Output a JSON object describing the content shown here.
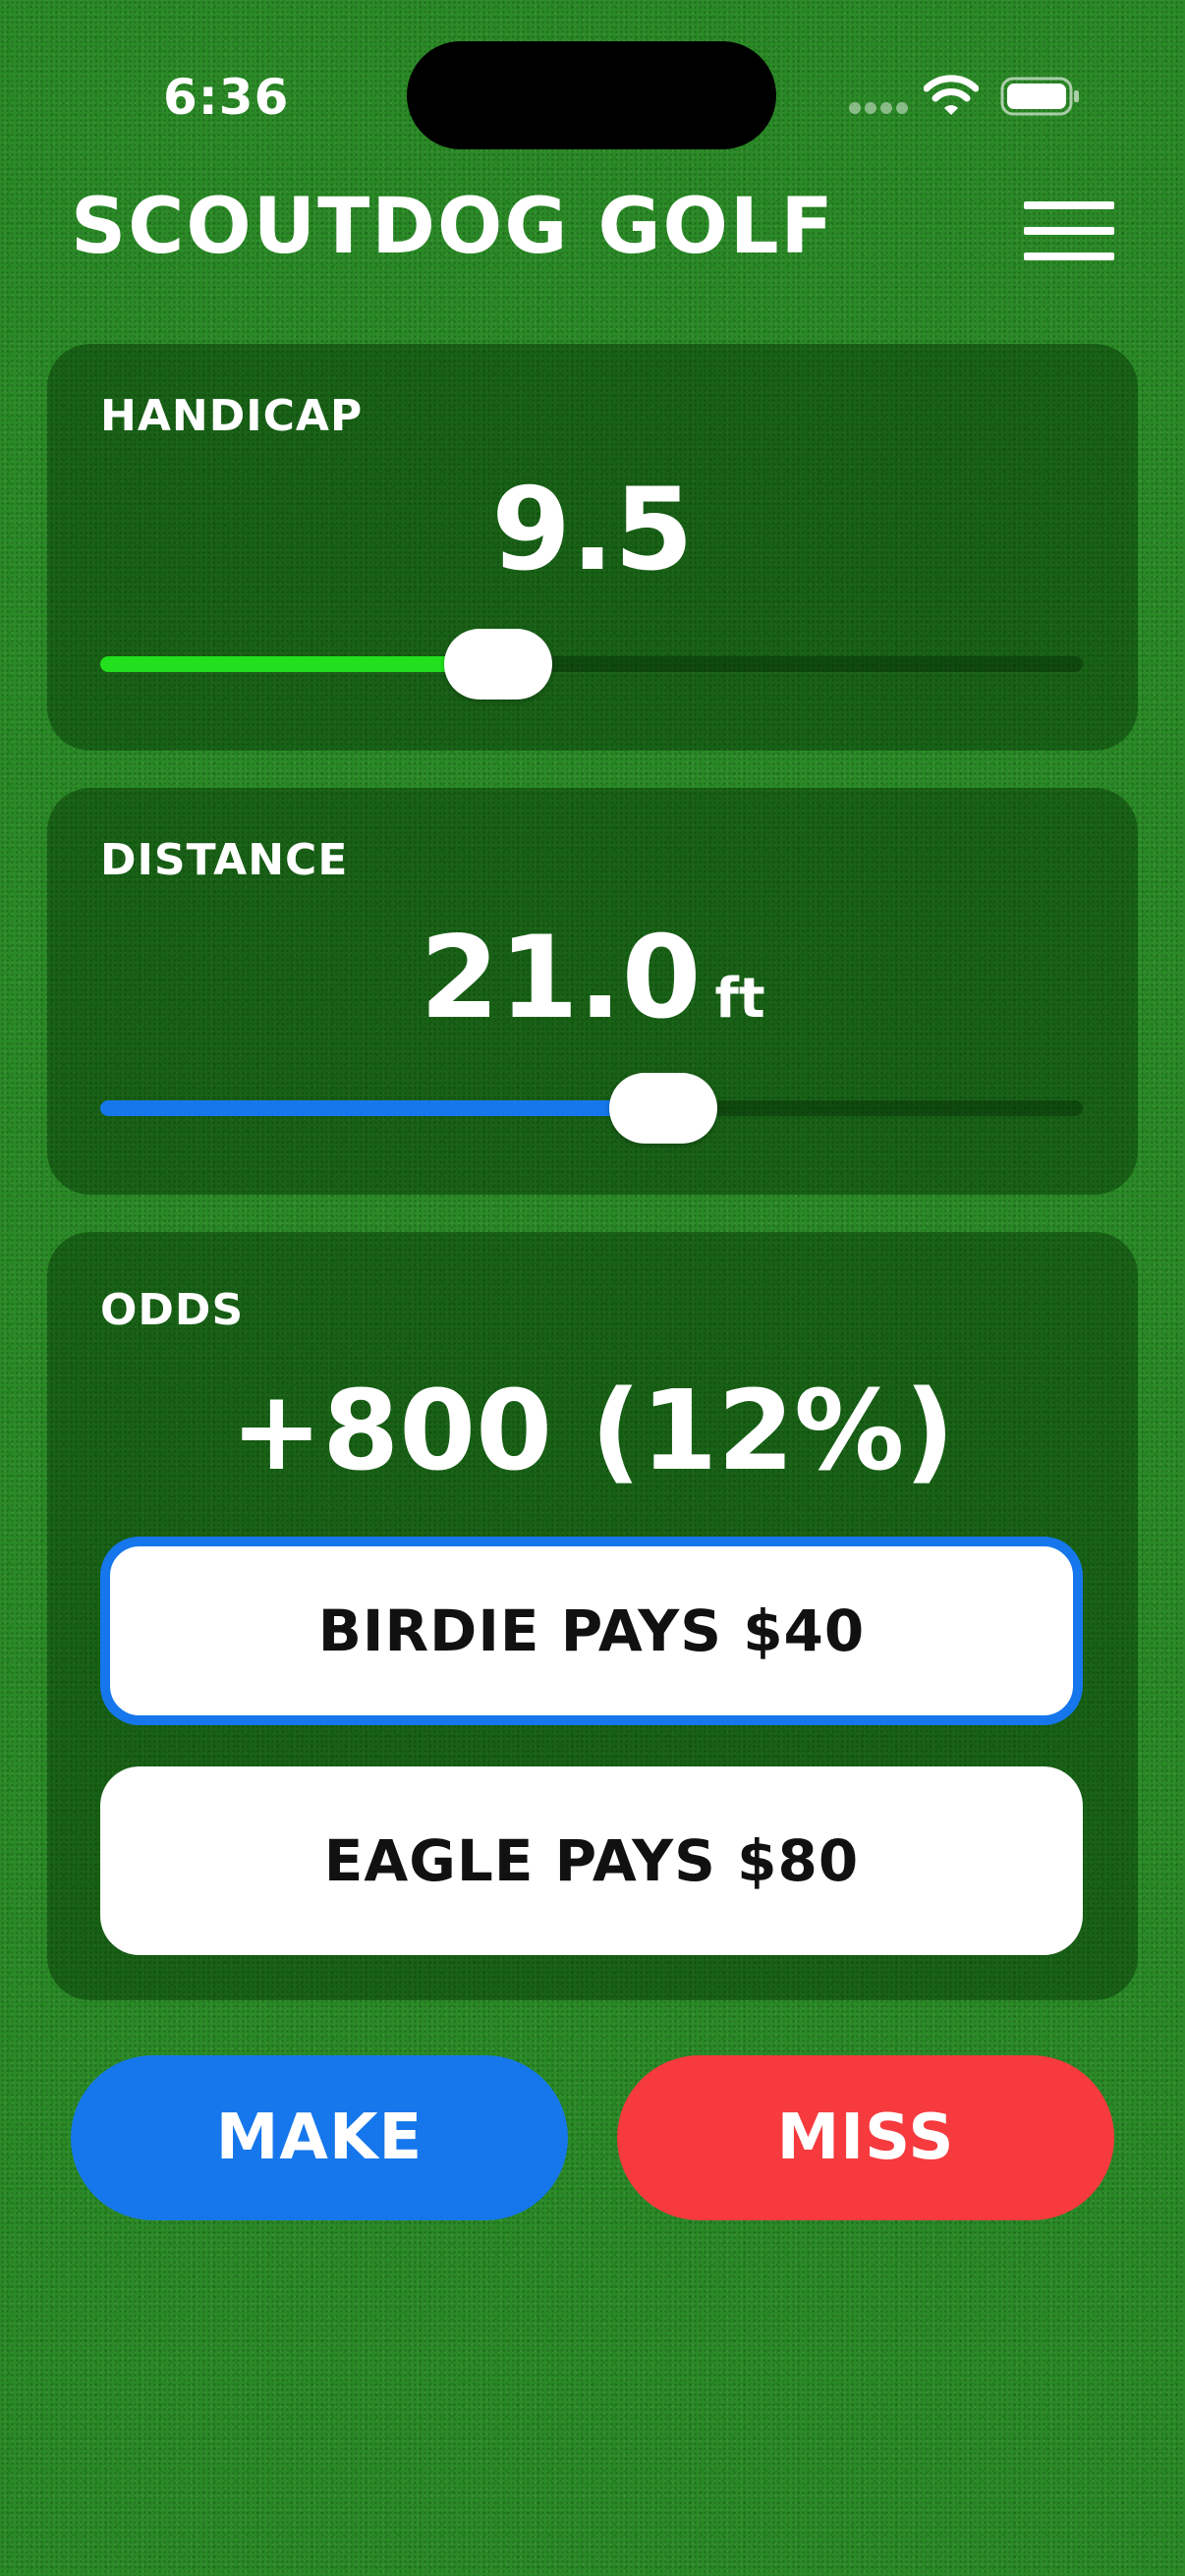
{
  "status_bar": {
    "time": "6:36"
  },
  "header": {
    "title": "SCOUTDOG GOLF",
    "menu_icon": "hamburger-menu-icon"
  },
  "handicap": {
    "label": "HANDICAP",
    "value": "9.5",
    "slider_fraction": 0.405,
    "fill_color": "#22e01e"
  },
  "distance": {
    "label": "DISTANCE",
    "value": "21.0",
    "unit": "ft",
    "slider_fraction": 0.573,
    "fill_color": "#1677ec"
  },
  "odds": {
    "label": "ODDS",
    "value": "+800 (12%)",
    "birdie_label": "BIRDIE PAYS $40",
    "eagle_label": "EAGLE PAYS $80",
    "selected_option": "birdie"
  },
  "actions": {
    "make_label": "MAKE",
    "miss_label": "MISS",
    "make_color": "#1677ec",
    "miss_color": "#f63a3e"
  },
  "colors": {
    "background": "#2a8a26",
    "accent_blue": "#1677ec",
    "accent_green": "#22e01e",
    "miss_red": "#f63a3e"
  }
}
